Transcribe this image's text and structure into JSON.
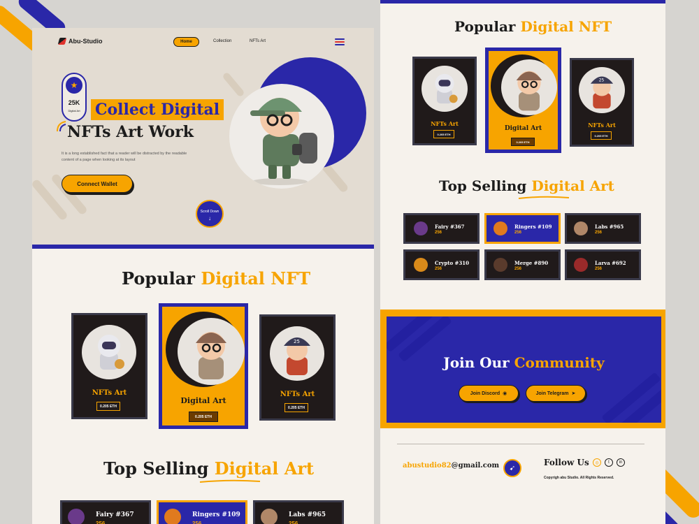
{
  "brand": {
    "name": "Abu-Studio"
  },
  "nav": {
    "home": "Home",
    "collection": "Collection",
    "nfts_art": "NFTs Art"
  },
  "hero": {
    "badge_count": "25K",
    "badge_label": "Digital Art",
    "title_line1": "Collect Digital",
    "title_line2": "NFTs Art Work",
    "description": "It is a long established fact that a reader will be distracted by the readable content of a page when looking at its layout",
    "cta": "Connect Wallet",
    "scroll": "Scroll Down"
  },
  "popular": {
    "title_plain": "Popular",
    "title_accent": "Digital NFT",
    "cards": [
      {
        "name": "NFTs Art",
        "price": "0.205 ETH",
        "icon": "astronaut-icon"
      },
      {
        "name": "Digital Art",
        "price": "0.205 ETH",
        "icon": "explorer-icon"
      },
      {
        "name": "NFTs Art",
        "price": "0.205 ETH",
        "icon": "firefighter-icon"
      }
    ]
  },
  "top_selling": {
    "title_plain": "Top Selling",
    "title_accent": "Digital Art",
    "items": [
      {
        "name": "Fairy #367",
        "value": "256"
      },
      {
        "name": "Ringers #109",
        "value": "256"
      },
      {
        "name": "Labs #965",
        "value": "256"
      },
      {
        "name": "Crypto #310",
        "value": "256"
      },
      {
        "name": "Merge #890",
        "value": "256"
      },
      {
        "name": "Larva #692",
        "value": "256"
      }
    ]
  },
  "community": {
    "title_plain": "Join Our",
    "title_accent": "Community",
    "discord": "Join Discord",
    "telegram": "Join Telegram"
  },
  "footer": {
    "email_accent": "abustudio82",
    "email_rest": "@gmail.com",
    "follow": "Follow Us",
    "copyright": "Copyrigh abu Studio. All Rights Reserved."
  },
  "colors": {
    "accent": "#f7a400",
    "primary": "#2a27a8",
    "dark": "#201a1a"
  }
}
